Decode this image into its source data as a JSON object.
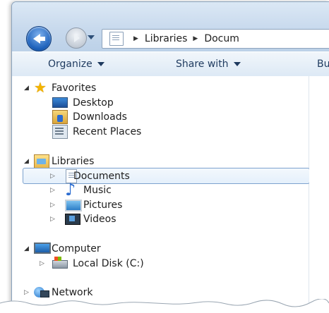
{
  "address": {
    "segments": [
      "Libraries",
      "Docum"
    ]
  },
  "toolbar": {
    "organize": "Organize",
    "share_with": "Share with",
    "truncated": "Bu"
  },
  "tree": {
    "favorites": {
      "label": "Favorites",
      "items": [
        {
          "label": "Desktop",
          "icon": "desktop-icon"
        },
        {
          "label": "Downloads",
          "icon": "downloads-icon"
        },
        {
          "label": "Recent Places",
          "icon": "recent-places-icon"
        }
      ]
    },
    "libraries": {
      "label": "Libraries",
      "items": [
        {
          "label": "Documents",
          "icon": "documents-icon",
          "selected": true
        },
        {
          "label": "Music",
          "icon": "music-icon"
        },
        {
          "label": "Pictures",
          "icon": "pictures-icon"
        },
        {
          "label": "Videos",
          "icon": "videos-icon"
        }
      ]
    },
    "computer": {
      "label": "Computer",
      "items": [
        {
          "label": "Local Disk (C:)",
          "icon": "local-disk-icon"
        }
      ]
    },
    "network": {
      "label": "Network"
    }
  },
  "colors": {
    "selection_border": "#7da2ce",
    "toolbar_text": "#1e3a5f",
    "chrome": "#c6d8ec"
  }
}
